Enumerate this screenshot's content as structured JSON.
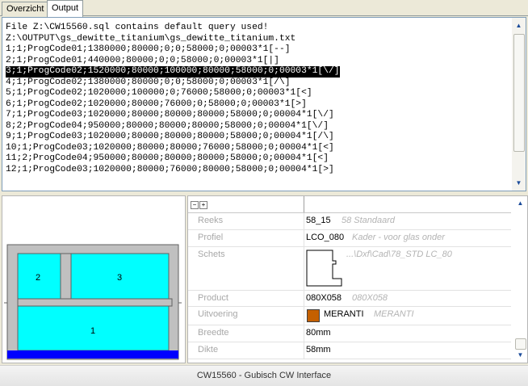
{
  "tabs": [
    {
      "label": "Overzicht",
      "active": false
    },
    {
      "label": "Output",
      "active": true
    }
  ],
  "output": {
    "lines": [
      "File Z:\\CW15560.sql contains default query used!",
      "Z:\\OUTPUT\\gs_dewitte_titanium\\gs_dewitte_titanium.txt",
      "1;1;ProgCode01;1380000;80000;0;0;58000;0;00003*1[--]",
      "2;1;ProgCode01;440000;80000;0;0;58000;0;00003*1[|]",
      "3;1;ProgCode02;1520000;80000;100000;80000;58000;0;00003*1[\\/]",
      "4;1;ProgCode02;1380000;80000;0;0;58000;0;00003*1[/\\]",
      "5;1;ProgCode02;1020000;100000;0;76000;58000;0;00003*1[<]",
      "6;1;ProgCode02;1020000;80000;76000;0;58000;0;00003*1[>]",
      "7;1;ProgCode03;1020000;80000;80000;80000;58000;0;00004*1[\\/]",
      "8;2;ProgCode04;950000;80000;80000;80000;58000;0;00004*1[\\/]",
      "9;1;ProgCode03;1020000;80000;80000;80000;58000;0;00004*1[/\\]",
      "10;1;ProgCode03;1020000;80000;80000;76000;58000;0;00004*1[<]",
      "11;2;ProgCode04;950000;80000;80000;80000;58000;0;00004*1[<]",
      "12;1;ProgCode03;1020000;80000;76000;80000;58000;0;00004*1[>]"
    ],
    "selected_line_index": 4
  },
  "preview": {
    "panes": [
      {
        "label": "2"
      },
      {
        "label": "3"
      },
      {
        "label": "1"
      }
    ],
    "colors": {
      "glass": "#00ffff",
      "frame": "#c0c0c0",
      "frame_outline": "#606060",
      "sill": "#0000ff"
    }
  },
  "properties": {
    "header_buttons": {
      "collapse": "−",
      "expand": "+"
    },
    "rows": [
      {
        "label": "Reeks",
        "value": "58_15",
        "hint": "58 Standaard"
      },
      {
        "label": "Profiel",
        "value": "LCO_080",
        "hint": "Kader - voor glas onder"
      },
      {
        "label": "Schets",
        "value": "",
        "hint": "...\\Dxf\\Cad\\78_STD LC_80"
      },
      {
        "label": "Product",
        "value": "080X058",
        "hint": "080X058"
      },
      {
        "label": "Uitvoering",
        "value": "MERANTI",
        "hint": "MERANTI"
      },
      {
        "label": "Breedte",
        "value": "80mm",
        "hint": ""
      },
      {
        "label": "Dikte",
        "value": "58mm",
        "hint": ""
      }
    ],
    "swatch_color": "#c46000"
  },
  "status": {
    "title": "CW15560 - Gubisch CW Interface"
  },
  "icons": {
    "scroll_up": "▲",
    "scroll_down": "▼"
  }
}
